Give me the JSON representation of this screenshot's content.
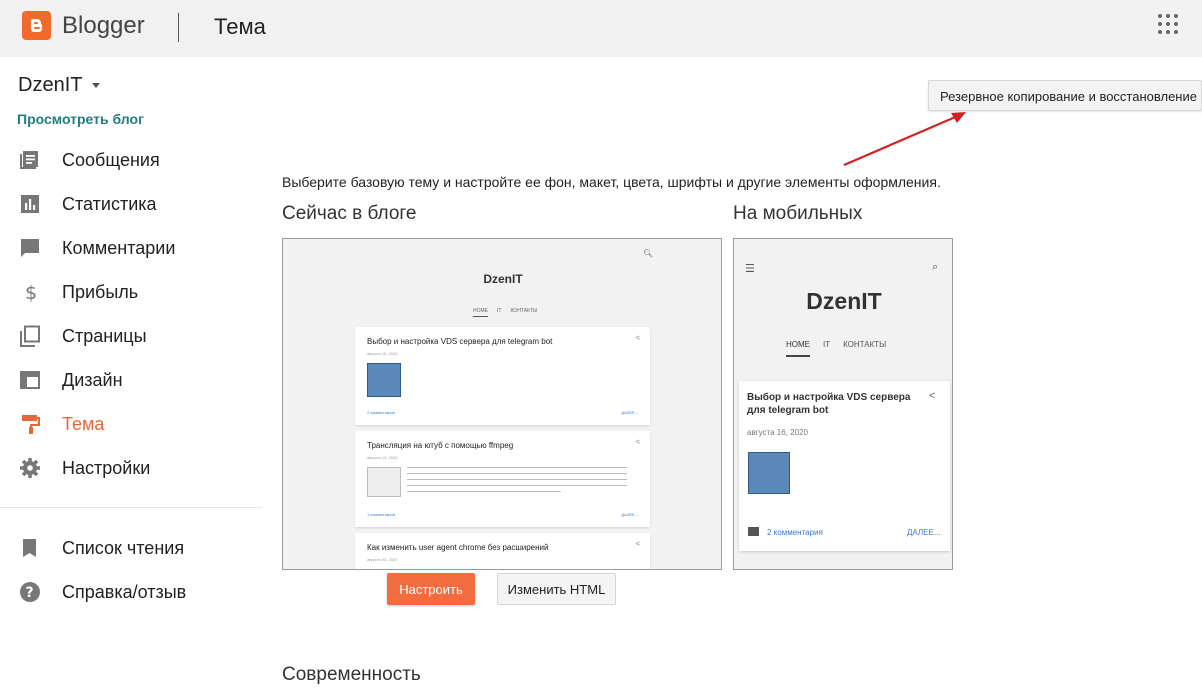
{
  "topbar": {
    "brand": "Blogger",
    "page_title": "Тема"
  },
  "sidebar": {
    "blog_name": "DzenIT",
    "view_blog": "Просмотреть блог",
    "items": [
      {
        "label": "Сообщения",
        "icon": "posts-icon"
      },
      {
        "label": "Статистика",
        "icon": "stats-icon"
      },
      {
        "label": "Комментарии",
        "icon": "comment-icon"
      },
      {
        "label": "Прибыль",
        "icon": "dollar-icon"
      },
      {
        "label": "Страницы",
        "icon": "pages-icon"
      },
      {
        "label": "Дизайн",
        "icon": "layout-icon"
      },
      {
        "label": "Тема",
        "icon": "paint-roller-icon",
        "active": true
      },
      {
        "label": "Настройки",
        "icon": "gear-icon"
      }
    ],
    "bottom_items": [
      {
        "label": "Список чтения",
        "icon": "bookmark-icon"
      },
      {
        "label": "Справка/отзыв",
        "icon": "help-icon"
      }
    ]
  },
  "main": {
    "backup_button": "Резервное копирование и восстановление",
    "intro": "Выберите базовую тему и настройте ее фон, макет, цвета, шрифты и другие элементы оформления.",
    "current_heading": "Сейчас в блоге",
    "mobile_heading": "На мобильных",
    "customize_button": "Настроить",
    "edit_html_button": "Изменить HTML",
    "next_section": "Современность"
  },
  "desktop_preview": {
    "title": "DzenIT",
    "tabs": [
      "HOME",
      "IT",
      "КОНТАКТЫ"
    ],
    "posts": [
      {
        "title": "Выбор и настройка VDS сервера для telegram bot",
        "date": "августа 16, 2020",
        "comments": "2 комментария",
        "more": "ДАЛЕЕ..."
      },
      {
        "title": "Трансляция на ютуб с помощью ffmpeg",
        "date": "августа 14, 2020",
        "comments": "1 комментарий",
        "more": "ДАЛЕЕ..."
      },
      {
        "title": "Как изменить user agent chrome без расширений",
        "date": "августа 03, 2020"
      }
    ]
  },
  "mobile_preview": {
    "title": "DzenIT",
    "tabs": [
      "HOME",
      "IT",
      "КОНТАКТЫ"
    ],
    "post": {
      "title": "Выбор и настройка VDS сервера для telegram bot",
      "date": "августа 16, 2020",
      "comments": "2 комментария",
      "more": "ДАЛЕЕ..."
    }
  },
  "colors": {
    "accent": "#e8663c",
    "link": "#1e7e80",
    "brand_orange": "#f26a2a"
  }
}
